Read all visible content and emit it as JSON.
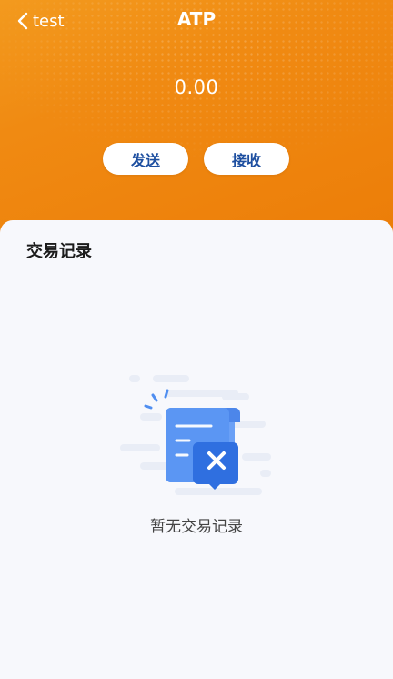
{
  "header": {
    "back_label": "test",
    "title": "ATP",
    "balance": "0.00",
    "send_label": "发送",
    "receive_label": "接收"
  },
  "transactions": {
    "section_title": "交易记录",
    "empty_text": "暂无交易记录"
  },
  "icons": {
    "back": "chevron-left-icon",
    "empty": "empty-records-icon"
  },
  "colors": {
    "header_orange": "#f08a12",
    "button_text": "#1e4fa0",
    "illustration_blue": "#2f6fe0"
  }
}
